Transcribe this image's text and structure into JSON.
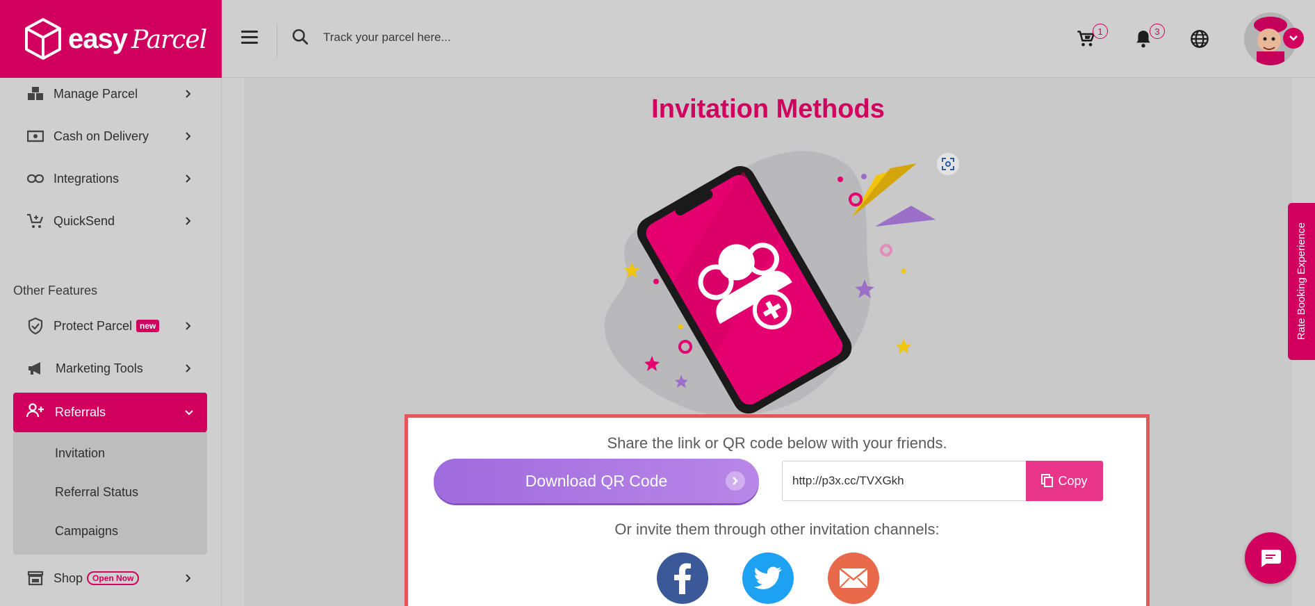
{
  "brand": {
    "name_easy": "easy",
    "name_parcel": "Parcel",
    "color": "#d1005f"
  },
  "header": {
    "search_placeholder": "Track your parcel here...",
    "cart_count": "1",
    "notification_count": "3"
  },
  "sidebar": {
    "items": [
      {
        "label": "Manage Parcel",
        "icon": "boxes-icon"
      },
      {
        "label": "Cash on Delivery",
        "icon": "cash-icon"
      },
      {
        "label": "Integrations",
        "icon": "link-icon"
      },
      {
        "label": "QuickSend",
        "icon": "cart-plus-icon"
      }
    ],
    "section_title": "Other Features",
    "features": [
      {
        "label": "Protect Parcel",
        "badge": "new",
        "icon": "shield-check-icon"
      },
      {
        "label": "Marketing Tools",
        "icon": "megaphone-icon"
      }
    ],
    "active": {
      "label": "Referrals",
      "icon": "user-plus-icon"
    },
    "subitems": [
      "Invitation",
      "Referral Status",
      "Campaigns"
    ],
    "shop": {
      "label": "Shop",
      "badge": "Open Now",
      "icon": "store-icon"
    }
  },
  "main": {
    "title": "Invitation Methods",
    "share_text": "Share the link or QR code below with your friends.",
    "download_label": "Download QR Code",
    "link_value": "http://p3x.cc/TVXGkh",
    "copy_label": "Copy",
    "invite_text": "Or invite them through other invitation channels:",
    "channels": [
      "facebook-icon",
      "twitter-icon",
      "email-icon"
    ]
  },
  "rate_tab": {
    "label": "Rate Booking Experience"
  },
  "colors": {
    "accent": "#d1005f",
    "purple": "#a06bdd",
    "facebook": "#3b5998",
    "twitter": "#1da1f2",
    "email": "#e86a4a"
  }
}
